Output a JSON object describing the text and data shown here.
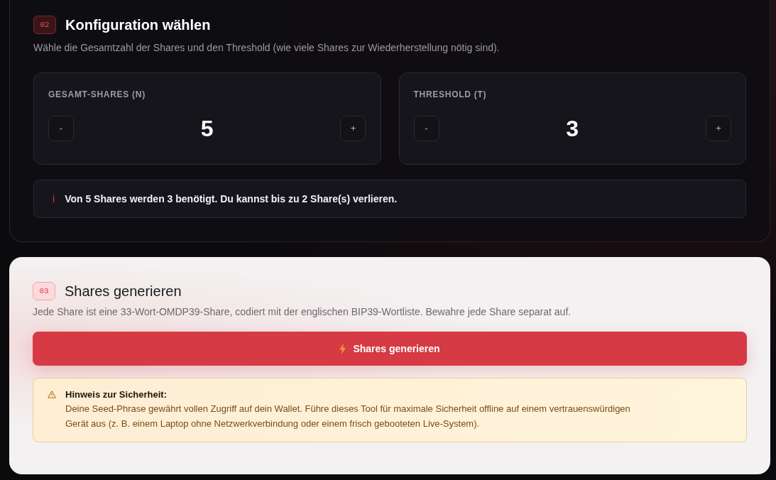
{
  "config_section": {
    "step": "02",
    "title": "Konfiguration wählen",
    "description": "Wähle die Gesamtzahl der Shares und den Threshold (wie viele Shares zur Wiederherstellung nötig sind).",
    "counters": [
      {
        "label": "GESAMT-SHARES (N)",
        "decrement": "-",
        "value": "5",
        "increment": "+"
      },
      {
        "label": "THRESHOLD (T)",
        "decrement": "-",
        "value": "3",
        "increment": "+"
      }
    ],
    "info": {
      "icon": "i",
      "text": "Von 5 Shares werden 3 benötigt. Du kannst bis zu 2 Share(s) verlieren."
    }
  },
  "generate_section": {
    "step": "03",
    "title": "Shares generieren",
    "description": "Jede Share ist eine 33-Wort-OMDP39-Share, codiert mit der englischen BIP39-Wortliste. Bewahre jede Share separat auf.",
    "button": "Shares generieren",
    "warning": {
      "title": "Hinweis zur Sicherheit:",
      "text": "Deine Seed-Phrase gewährt vollen Zugriff auf dein Wallet. Führe dieses Tool für maximale Sicherheit offline auf einem vertrauenswürdigen Gerät aus (z. B. einem Laptop ohne Netzwerkverbindung oder einem frisch gebooteten Live-System)."
    }
  }
}
